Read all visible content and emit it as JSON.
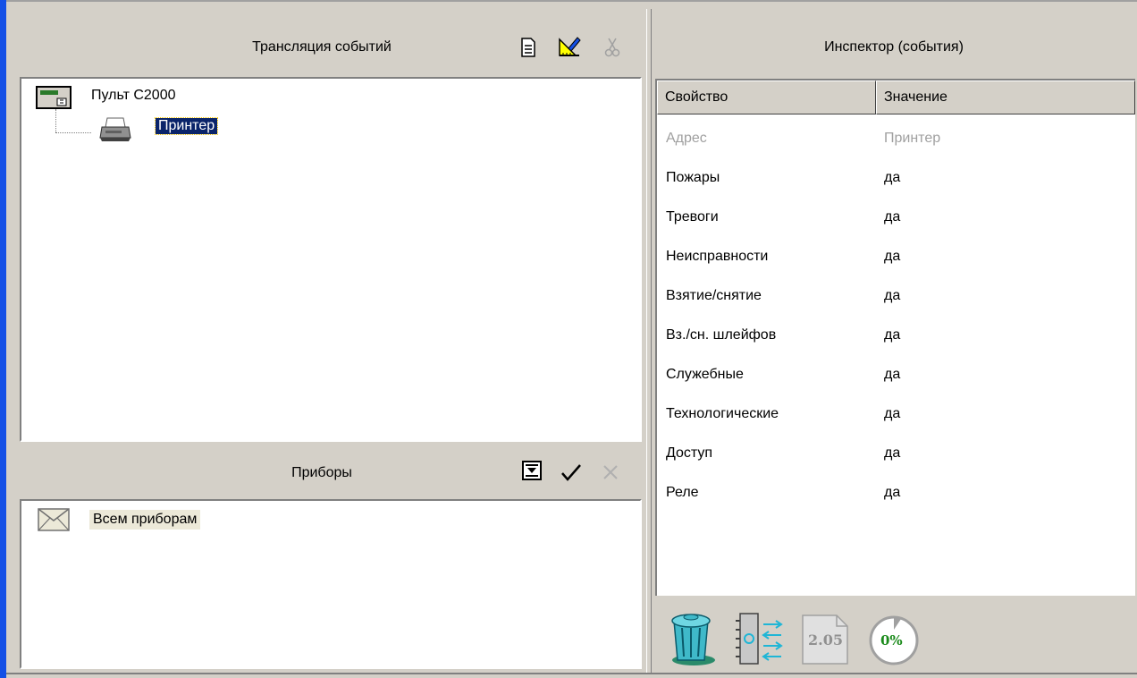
{
  "left": {
    "translation": {
      "title": "Трансляция событий",
      "toolbar": [
        "new-document-icon",
        "edit-ruler-icon",
        "cut-icon"
      ],
      "tree": {
        "root": "Пульт С2000",
        "child": "Принтер"
      }
    },
    "devices": {
      "title": "Приборы",
      "toolbar": [
        "import-icon",
        "check-icon",
        "remove-icon"
      ],
      "items": [
        "Всем приборам"
      ]
    }
  },
  "inspector": {
    "title": "Инспектор (события)",
    "headers": [
      "Свойство",
      "Значение"
    ],
    "rows": [
      {
        "key": "Адрес",
        "value": "Принтер",
        "disabled": true
      },
      {
        "key": "Пожары",
        "value": "да"
      },
      {
        "key": "Тревоги",
        "value": "да"
      },
      {
        "key": "Неисправности",
        "value": "да"
      },
      {
        "key": "Взятие/снятие",
        "value": "да"
      },
      {
        "key": "Вз./сн. шлейфов",
        "value": "да"
      },
      {
        "key": "Служебные",
        "value": "да"
      },
      {
        "key": "Технологические",
        "value": "да"
      },
      {
        "key": "Доступ",
        "value": "да"
      },
      {
        "key": "Реле",
        "value": "да"
      }
    ],
    "bottom_toolbar": {
      "icons": [
        "trash-icon",
        "device-transfer-icon",
        "version-icon",
        "progress-icon"
      ],
      "version_label": "2.05",
      "progress_label": "0%"
    }
  },
  "colors": {
    "selection": "#0a246a",
    "panel": "#d4d0c8",
    "accent_left_edge": "#1450e6"
  }
}
